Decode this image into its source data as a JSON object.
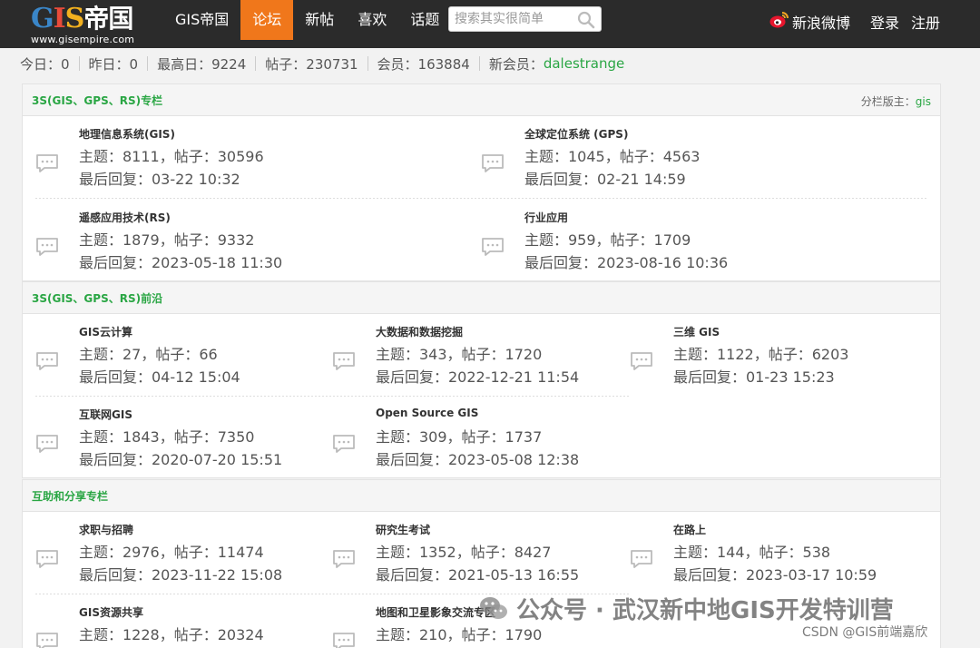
{
  "header": {
    "logo_text": "GIS帝国",
    "logo_url": "www.gisempire.com",
    "nav": [
      {
        "label": "GIS帝国",
        "active": false
      },
      {
        "label": "论坛",
        "active": true
      },
      {
        "label": "新帖",
        "active": false
      },
      {
        "label": "喜欢",
        "active": false
      },
      {
        "label": "话题",
        "active": false
      }
    ],
    "search_placeholder": "搜索其实很简单",
    "weibo_label": "新浪微博",
    "login_label": "登录",
    "register_label": "注册"
  },
  "stats": {
    "today": "今日：0",
    "yesterday": "昨日：0",
    "max_day": "最高日：9224",
    "posts": "帖子：230731",
    "members": "会员：163884",
    "new_member_label": "新会员：",
    "new_member": "dalestrange"
  },
  "sections": [
    {
      "title": "3S(GIS、GPS、RS)专栏",
      "moderator_label": "分栏版主：",
      "moderator": "gis",
      "forums": [
        {
          "name": "地理信息系统(GIS)",
          "stats": "主题：8111，帖子：30596",
          "last": "最后回复：03-22 10:32"
        },
        {
          "name": "全球定位系统 (GPS)",
          "stats": "主题：1045，帖子：4563",
          "last": "最后回复：02-21 14:59"
        },
        {
          "name": "遥感应用技术(RS)",
          "stats": "主题：1879，帖子：9332",
          "last": "最后回复：2023-05-18 11:30"
        },
        {
          "name": "行业应用",
          "stats": "主题：959，帖子：1709",
          "last": "最后回复：2023-08-16 10:36"
        }
      ]
    },
    {
      "title": "3S(GIS、GPS、RS)前沿",
      "forums": [
        {
          "name": "GIS云计算",
          "stats": "主题：27，帖子：66",
          "last": "最后回复：04-12 15:04"
        },
        {
          "name": "大数据和数据挖掘",
          "stats": "主题：343，帖子：1720",
          "last": "最后回复：2022-12-21 11:54"
        },
        {
          "name": "三维 GIS",
          "stats": "主题：1122，帖子：6203",
          "last": "最后回复：01-23 15:23"
        },
        {
          "name": "互联网GIS",
          "stats": "主题：1843，帖子：7350",
          "last": "最后回复：2020-07-20 15:51"
        },
        {
          "name": "Open Source GIS",
          "stats": "主题：309，帖子：1737",
          "last": "最后回复：2023-05-08 12:38"
        }
      ]
    },
    {
      "title": "互助和分享专栏",
      "forums": [
        {
          "name": "求职与招聘",
          "stats": "主题：2976，帖子：11474",
          "last": "最后回复：2023-11-22 15:08"
        },
        {
          "name": "研究生考试",
          "stats": "主题：1352，帖子：8427",
          "last": "最后回复：2021-05-13 16:55"
        },
        {
          "name": "在路上",
          "stats": "主题：144，帖子：538",
          "last": "最后回复：2023-03-17 10:59"
        },
        {
          "name": "GIS资源共享",
          "stats": "主题：1228，帖子：20324",
          "last": ""
        },
        {
          "name": "地图和卫星影象交流专区",
          "stats": "主题：210，帖子：1790",
          "last": ""
        }
      ]
    }
  ],
  "watermark": {
    "text": "公众号 · 武汉新中地GIS开发特训营",
    "credit": "CSDN @GIS前端嘉欣"
  },
  "colors": {
    "topbar": "#2b2b2b",
    "nav_active": "#f0771b",
    "accent_green": "#2aa644"
  }
}
